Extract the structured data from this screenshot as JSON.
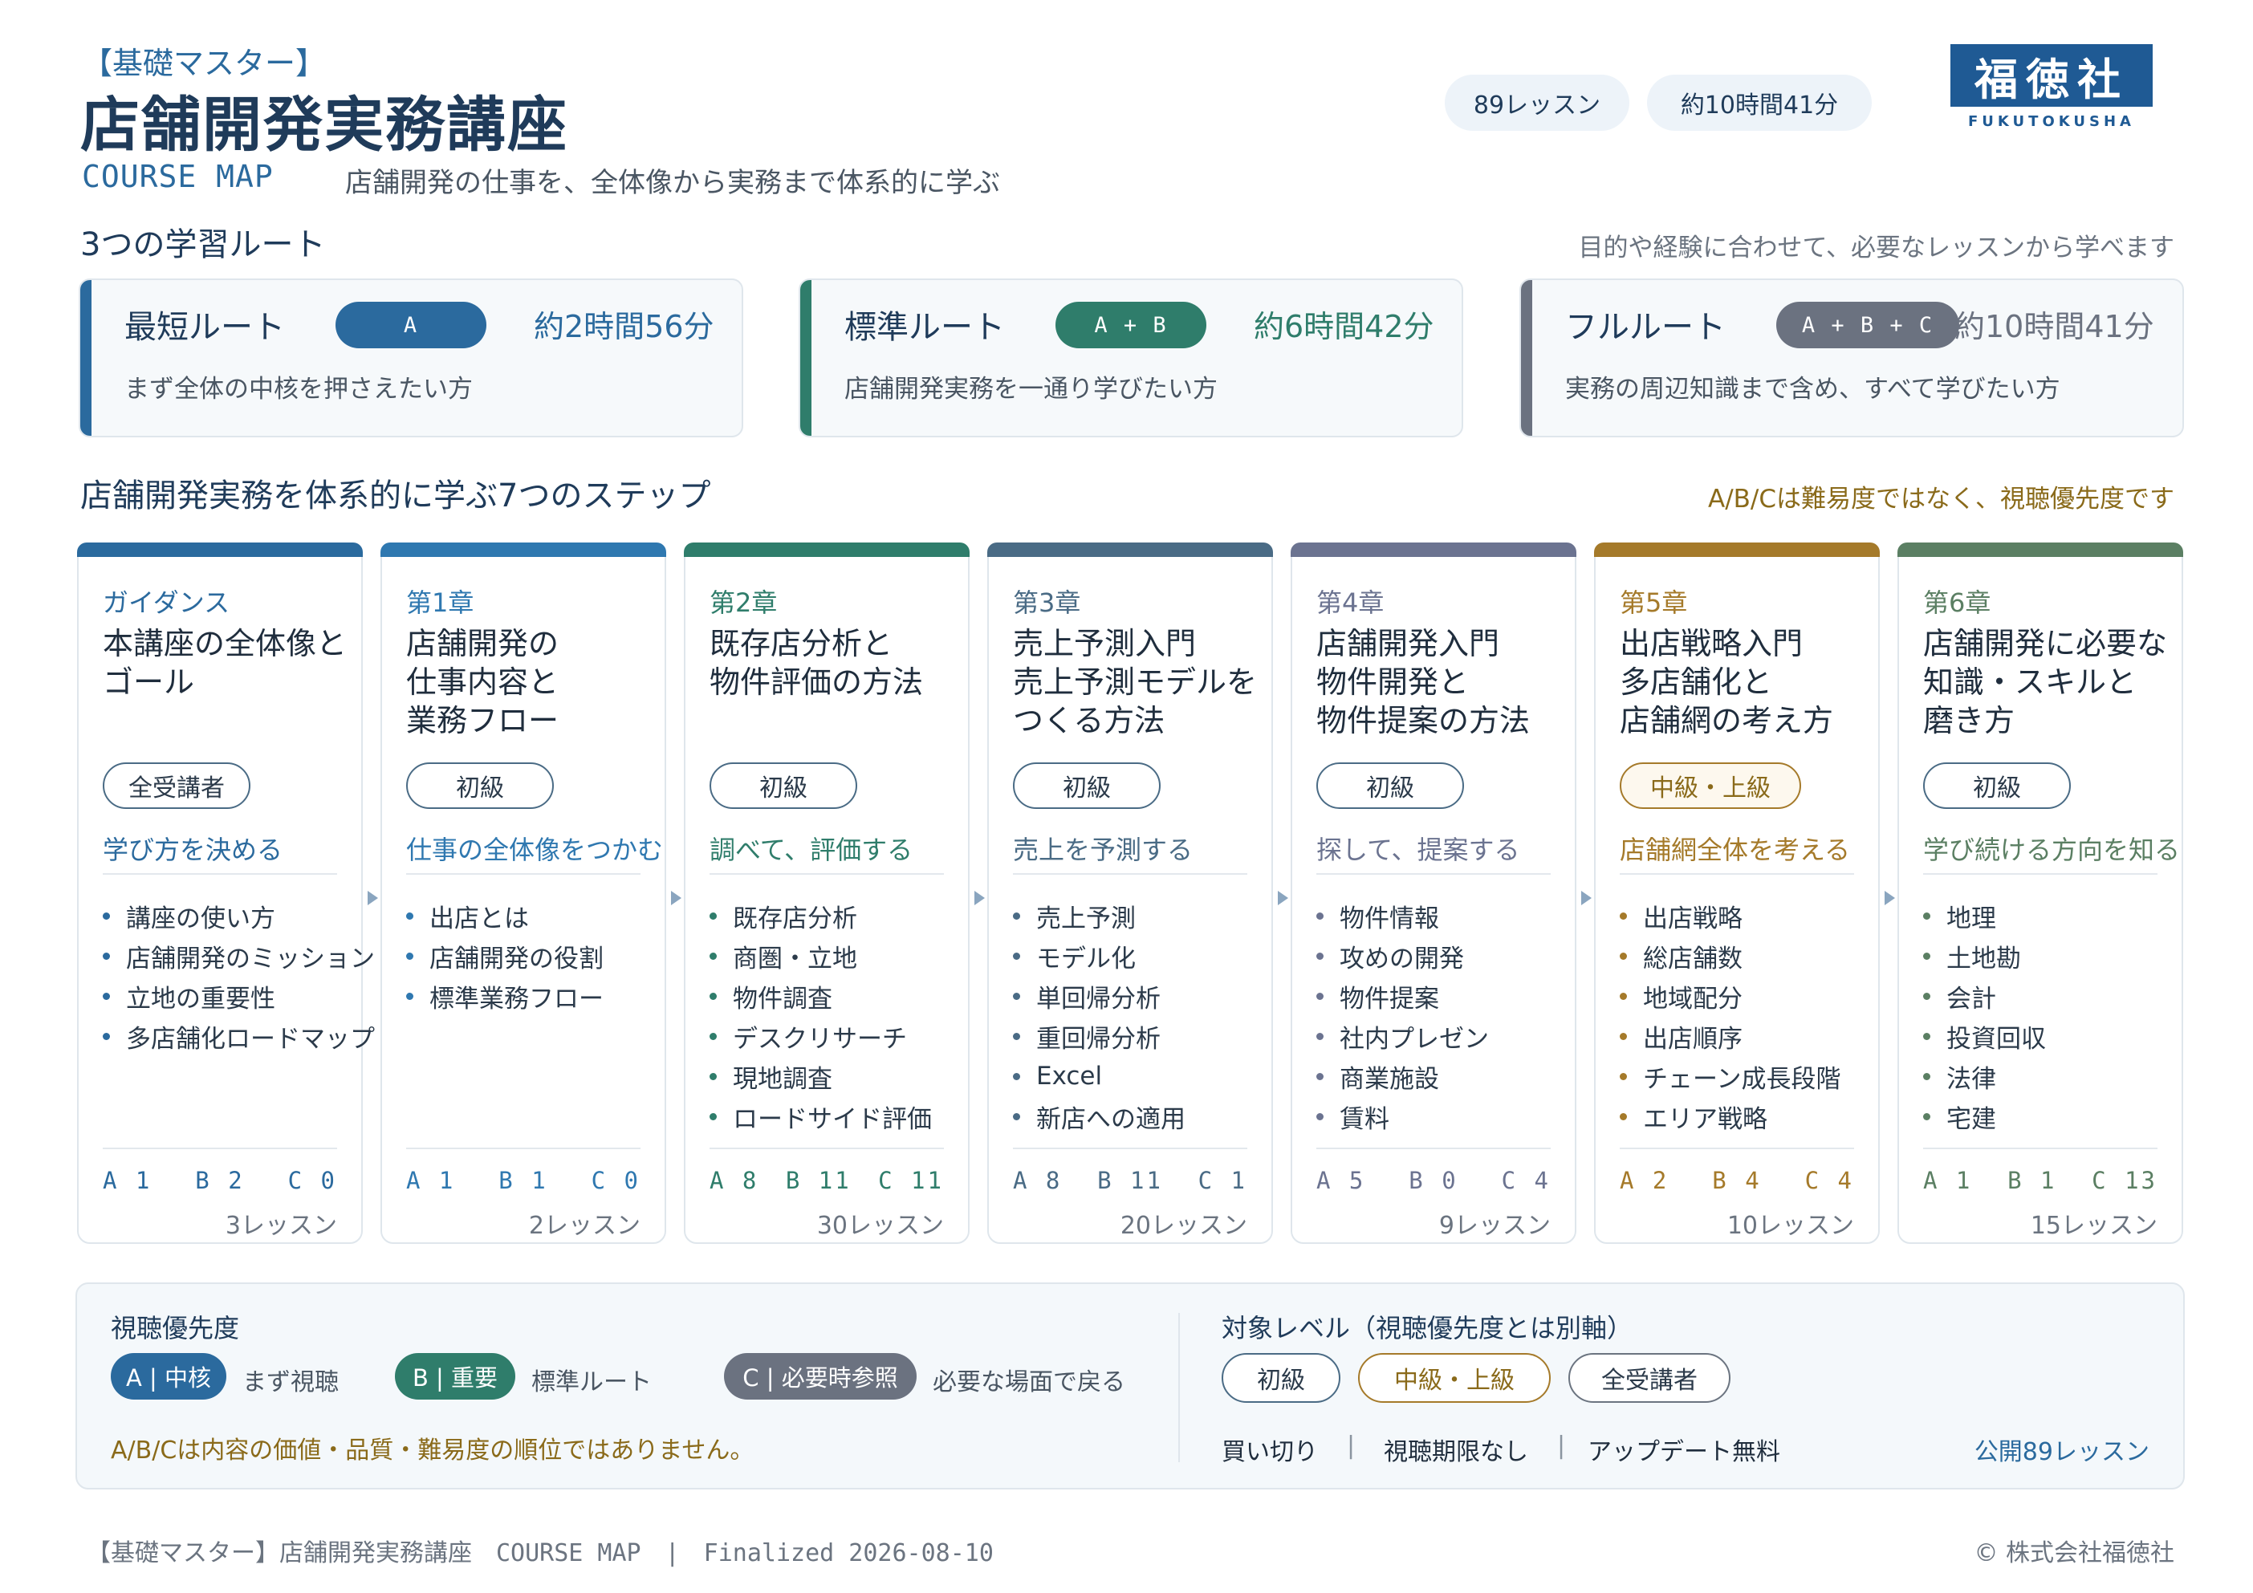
{
  "header": {
    "kicker": "【基礎マスター】",
    "title": "店舗開発実務講座",
    "course_map": "COURSE MAP",
    "tagline": "店舗開発の仕事を、全体像から実務まで体系的に学ぶ",
    "lessons_badge": "89レッスン",
    "duration_badge": "約10時間41分",
    "logo_text": "福徳社",
    "logo_sub": "FUKUTOKUSHA"
  },
  "routes_section": {
    "title": "3つの学習ルート",
    "note": "目的や経験に合わせて、必要なレッスンから学べます",
    "routes": [
      {
        "name": "最短ルート",
        "pill": "A",
        "time": "約2時間56分",
        "desc": "まず全体の中核を押さえたい方",
        "color": "#2b6a9e"
      },
      {
        "name": "標準ルート",
        "pill": "A + B",
        "time": "約6時間42分",
        "desc": "店舗開発実務を一通り学びたい方",
        "color": "#2f7d6b"
      },
      {
        "name": "フルルート",
        "pill": "A + B + C",
        "time": "約10時間41分",
        "desc": "実務の周辺知識まで含め、すべて学びたい方",
        "color": "#6b7280"
      }
    ]
  },
  "steps_section": {
    "title": "店舗開発実務を体系的に学ぶ7つのステップ",
    "note": "A/B/Cは難易度ではなく、視聴優先度です",
    "steps": [
      {
        "chapter": "ガイダンス",
        "title": "本講座の全体像と\nゴール",
        "level": "全受講者",
        "goal": "学び方を決める",
        "items": [
          "講座の使い方",
          "店舗開発のミッション",
          "立地の重要性",
          "多店舗化ロードマップ"
        ],
        "a": "A 1",
        "b": "B 2",
        "c": "C 0",
        "count": "3レッスン",
        "color": "#2b6a9e"
      },
      {
        "chapter": "第1章",
        "title": "店舗開発の\n仕事内容と\n業務フロー",
        "level": "初級",
        "goal": "仕事の全体像をつかむ",
        "items": [
          "出店とは",
          "店舗開発の役割",
          "標準業務フロー"
        ],
        "a": "A 1",
        "b": "B 1",
        "c": "C 0",
        "count": "2レッスン",
        "color": "#2f78b0"
      },
      {
        "chapter": "第2章",
        "title": "既存店分析と\n物件評価の方法",
        "level": "初級",
        "goal": "調べて、評価する",
        "items": [
          "既存店分析",
          "商圏・立地",
          "物件調査",
          "デスクリサーチ",
          "現地調査",
          "ロードサイド評価"
        ],
        "a": "A 8",
        "b": "B 11",
        "c": "C 11",
        "count": "30レッスン",
        "color": "#2f7d6b"
      },
      {
        "chapter": "第3章",
        "title": "売上予測入門\n売上予測モデルを\nつくる方法",
        "level": "初級",
        "goal": "売上を予測する",
        "items": [
          "売上予測",
          "モデル化",
          "単回帰分析",
          "重回帰分析",
          "Excel",
          "新店への適用"
        ],
        "a": "A 8",
        "b": "B 11",
        "c": "C 1",
        "count": "20レッスン",
        "color": "#4a6b85"
      },
      {
        "chapter": "第4章",
        "title": "店舗開発入門\n物件開発と\n物件提案の方法",
        "level": "初級",
        "goal": "探して、提案する",
        "items": [
          "物件情報",
          "攻めの開発",
          "物件提案",
          "社内プレゼン",
          "商業施設",
          "賃料"
        ],
        "a": "A 5",
        "b": "B 0",
        "c": "C 4",
        "count": "9レッスン",
        "color": "#6b7390"
      },
      {
        "chapter": "第5章",
        "title": "出店戦略入門\n多店舗化と\n店舗網の考え方",
        "level": "中級・上級",
        "goal": "店舗網全体を考える",
        "items": [
          "出店戦略",
          "総店舗数",
          "地域配分",
          "出店順序",
          "チェーン成長段階",
          "エリア戦略"
        ],
        "a": "A 2",
        "b": "B 4",
        "c": "C 4",
        "count": "10レッスン",
        "color": "#a57a2a"
      },
      {
        "chapter": "第6章",
        "title": "店舗開発に必要な\n知識・スキルと\n磨き方",
        "level": "初級",
        "goal": "学び続ける方向を知る",
        "items": [
          "地理",
          "土地勘",
          "会計",
          "投資回収",
          "法律",
          "宅建"
        ],
        "a": "A 1",
        "b": "B 1",
        "c": "C 13",
        "count": "15レッスン",
        "color": "#5b7f63"
      }
    ]
  },
  "legend": {
    "priority_title": "視聴優先度",
    "a_label": "A | 中核",
    "a_desc": "まず視聴",
    "b_label": "B | 重要",
    "b_desc": "標準ルート",
    "c_label": "C | 必要時参照",
    "c_desc": "必要な場面で戻る",
    "note": "A/B/Cは内容の価値・品質・難易度の順位ではありません。",
    "level_title": "対象レベル（視聴優先度とは別軸）",
    "lvl_beginner": "初級",
    "lvl_mid": "中級・上級",
    "lvl_all": "全受講者",
    "meta1": "買い切り",
    "meta2": "視聴期限なし",
    "meta3": "アップデート無料",
    "sep": "|",
    "published": "公開89レッスン"
  },
  "footer": {
    "left": "【基礎マスター】店舗開発実務講座　COURSE MAP　|　Finalized 2026-08-10",
    "right": "© 株式会社福徳社"
  }
}
